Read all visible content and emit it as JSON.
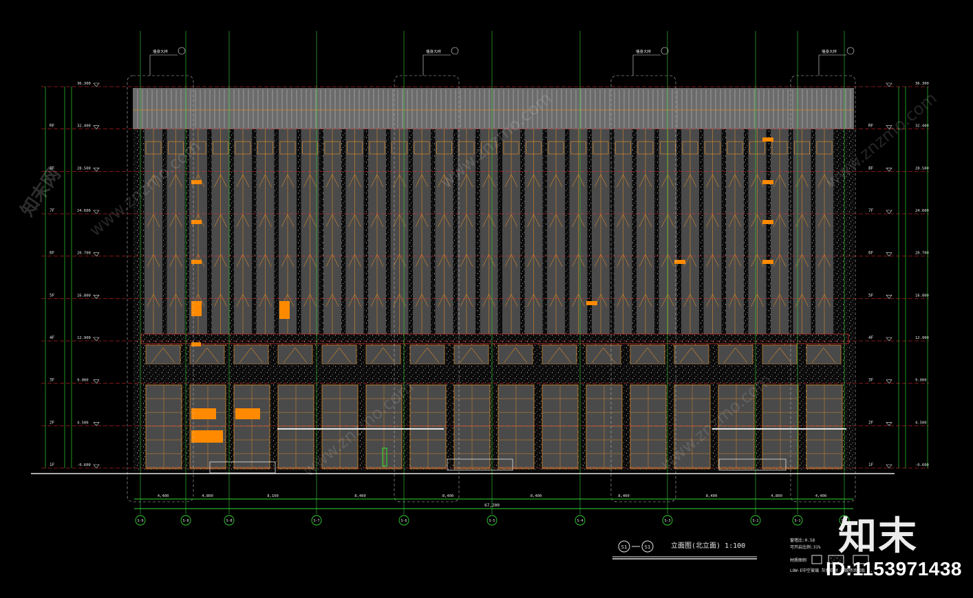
{
  "drawing": {
    "title": "立面图(北立面) 1:100",
    "section_marks": [
      "S1",
      "S1"
    ],
    "notes": [
      "窗墙比:0.58",
      "可开启比例:31%",
      "材质图例"
    ],
    "material_note": "LOW-E中空玻璃 灰色石材 氟碳喷涂铝板 ...",
    "total_dimension": "67,200"
  },
  "floors": [
    {
      "label": "1F",
      "elevation": "-0.600"
    },
    {
      "label": "2F",
      "elevation": "4.500"
    },
    {
      "label": "3F",
      "elevation": "9.000"
    },
    {
      "label": "4F",
      "elevation": "12.900"
    },
    {
      "label": "5F",
      "elevation": "16.800"
    },
    {
      "label": "6F",
      "elevation": "20.700"
    },
    {
      "label": "7F",
      "elevation": "24.600"
    },
    {
      "label": "8F",
      "elevation": "28.500"
    },
    {
      "label": "RF",
      "elevation": "32.400"
    },
    {
      "label": "",
      "elevation": "36.300"
    }
  ],
  "axes": [
    "S-9",
    "S-8",
    "S-8",
    "S-7",
    "S-6",
    "S-5",
    "S-4",
    "S-3",
    "S-2",
    "S-1",
    "S-1"
  ],
  "bottom_dimensions": [
    "4,400",
    "4,800",
    "8,100",
    "8,400",
    "8,400",
    "8,400",
    "8,400",
    "8,400",
    "4,800",
    "4,400"
  ],
  "detail_tags": [
    "墙身大样",
    "墙身大样",
    "墙身大样",
    "墙身大样"
  ],
  "watermark": {
    "brand": "知末",
    "id_text": "ID:1153971438",
    "site": "www.znzmo.com",
    "side_text": "知末网"
  },
  "colors": {
    "background": "#000000",
    "glass": "#4a4a4a",
    "mullion": "#d98a2a",
    "stone": "#0b0b0b",
    "accent": "#ff8a00",
    "level_line": "#ff3030",
    "dim_line": "#35d435"
  }
}
